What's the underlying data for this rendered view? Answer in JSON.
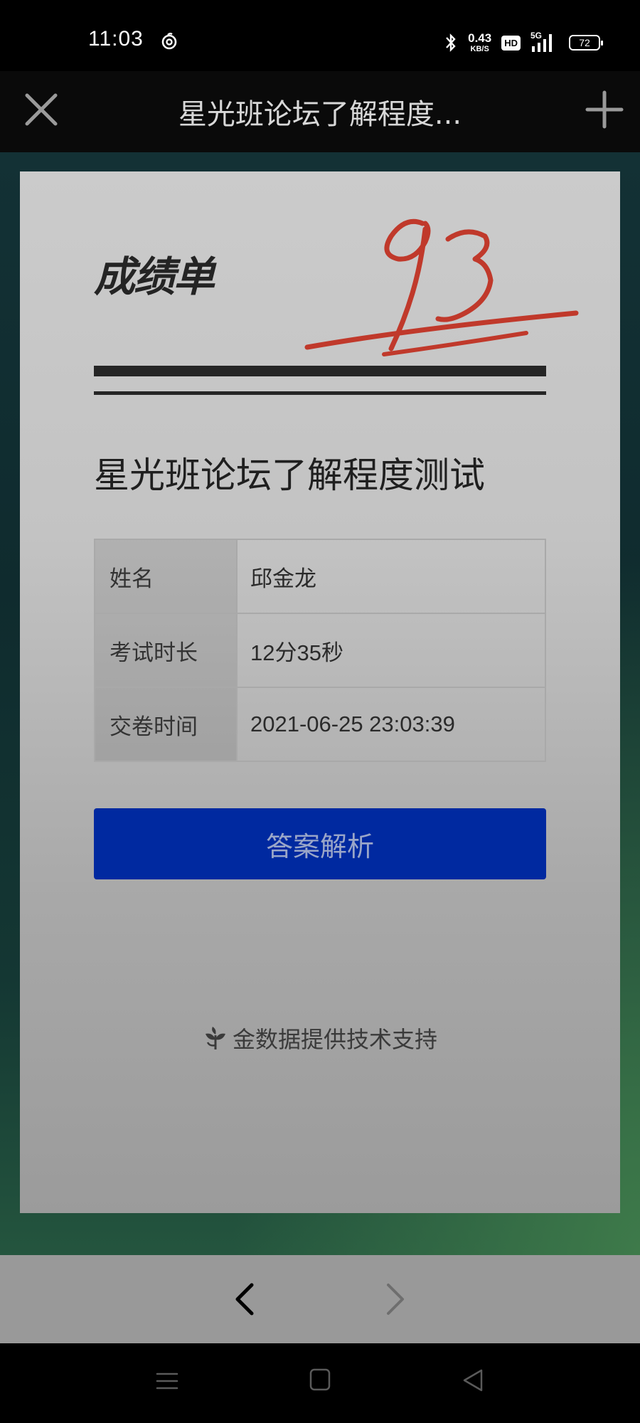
{
  "status_bar": {
    "time": "11:03",
    "net_speed_value": "0.43",
    "net_speed_unit": "KB/S",
    "hd_label": "HD",
    "network_label": "5G",
    "battery_level": "72"
  },
  "header": {
    "title": "星光班论坛了解程度..."
  },
  "result": {
    "card_title": "成绩单",
    "score": "93",
    "exam_title": "星光班论坛了解程度测试",
    "info_rows": [
      {
        "label": "姓名",
        "value": "邱金龙"
      },
      {
        "label": "考试时长",
        "value": "12分35秒"
      },
      {
        "label": "交卷时间",
        "value": "2021-06-25 23:03:39"
      }
    ],
    "answer_button_label": "答案解析",
    "powered_by": "金数据提供技术支持"
  },
  "colors": {
    "score_red": "#c0392b",
    "button_blue": "#0029a0"
  },
  "icons": {
    "close": "close-icon",
    "add": "plus-icon",
    "back": "chevron-left-icon",
    "forward": "chevron-right-icon",
    "logo": "jinshuju-logo-icon"
  }
}
